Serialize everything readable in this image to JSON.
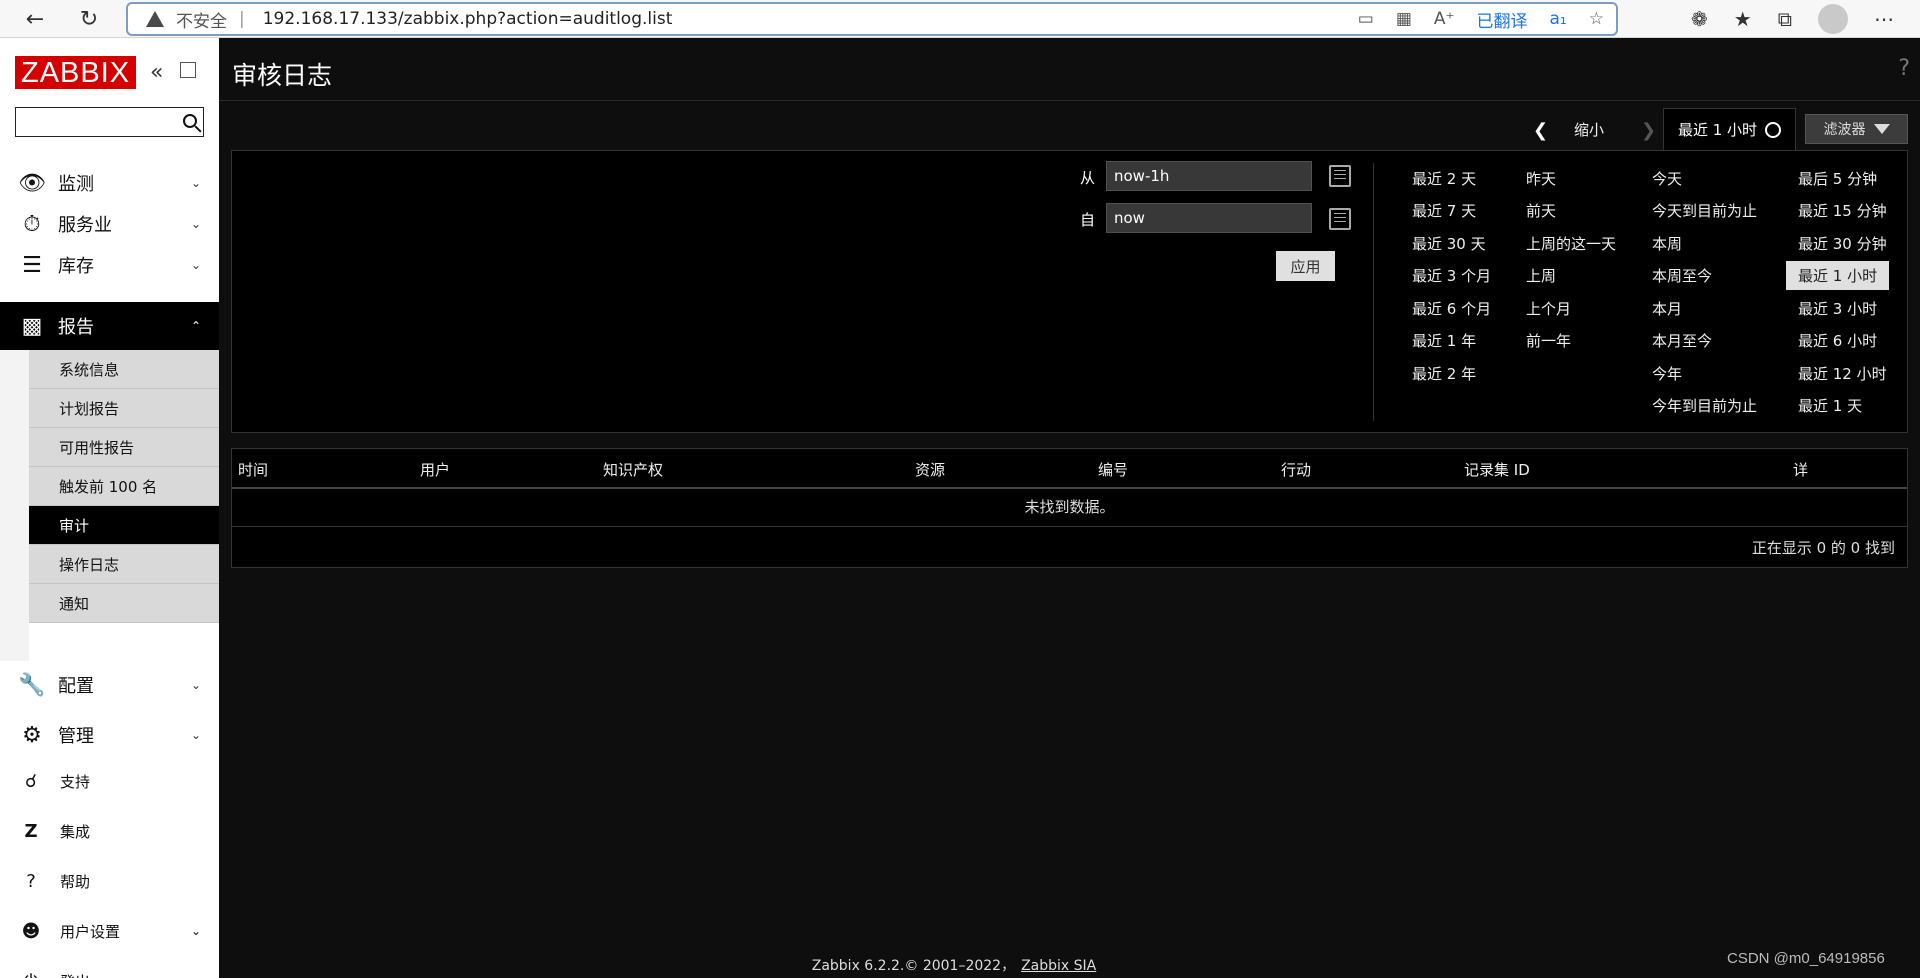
{
  "browser": {
    "insecure_label": "不安全",
    "url": "192.168.17.133/zabbix.php?action=auditlog.list",
    "translated_label": "已翻译"
  },
  "sidebar": {
    "logo": "ZABBIX",
    "search_placeholder": "",
    "menu": [
      {
        "label": "监测",
        "icon": "eye-icon"
      },
      {
        "label": "服务业",
        "icon": "stopwatch-icon"
      },
      {
        "label": "库存",
        "icon": "list-icon"
      },
      {
        "label": "报告",
        "icon": "bar-chart-icon"
      },
      {
        "label": "配置",
        "icon": "wrench-icon"
      },
      {
        "label": "管理",
        "icon": "gear-icon"
      }
    ],
    "submenu": [
      "系统信息",
      "计划报告",
      "可用性报告",
      "触发前 100 名",
      "审计",
      "操作日志",
      "通知"
    ],
    "bottom": [
      {
        "label": "支持",
        "icon": "headset-icon"
      },
      {
        "label": "集成",
        "icon": "z-icon"
      },
      {
        "label": "帮助",
        "icon": "question-icon"
      },
      {
        "label": "用户设置",
        "icon": "user-icon"
      },
      {
        "label": "登出",
        "icon": "power-icon"
      }
    ]
  },
  "header": {
    "title": "审核日志",
    "help": "?"
  },
  "filter": {
    "zoom_out": "缩小",
    "time_tab": "最近 1 小时",
    "filter_tab": "滤波器",
    "from_label": "从",
    "to_label": "自",
    "from_value": "now-1h",
    "to_value": "now",
    "apply": "应用",
    "quick_col1": [
      "最近 2 天",
      "最近 7 天",
      "最近 30 天",
      "最近 3 个月",
      "最近 6 个月",
      "最近 1 年",
      "最近 2 年"
    ],
    "quick_col2": [
      "昨天",
      "前天",
      "上周的这一天",
      "上周",
      "上个月",
      "前一年"
    ],
    "quick_col3": [
      "今天",
      "今天到目前为止",
      "本周",
      "本周至今",
      "本月",
      "本月至今",
      "今年",
      "今年到目前为止"
    ],
    "quick_col4": [
      "最后 5 分钟",
      "最近 15 分钟",
      "最近 30 分钟",
      "最近 1 小时",
      "最近 3 小时",
      "最近 6 小时",
      "最近 12 小时",
      "最近 1 天"
    ]
  },
  "table": {
    "columns": [
      "时间",
      "用户",
      "知识产权",
      "资源",
      "编号",
      "行动",
      "记录集 ID",
      "详"
    ],
    "empty_text": "未找到数据。",
    "paging": "正在显示 0 的 0 找到"
  },
  "footer": {
    "text": "Zabbix 6.2.2.© 2001–2022，",
    "link": "Zabbix SIA"
  },
  "watermark": "CSDN @m0_64919856"
}
